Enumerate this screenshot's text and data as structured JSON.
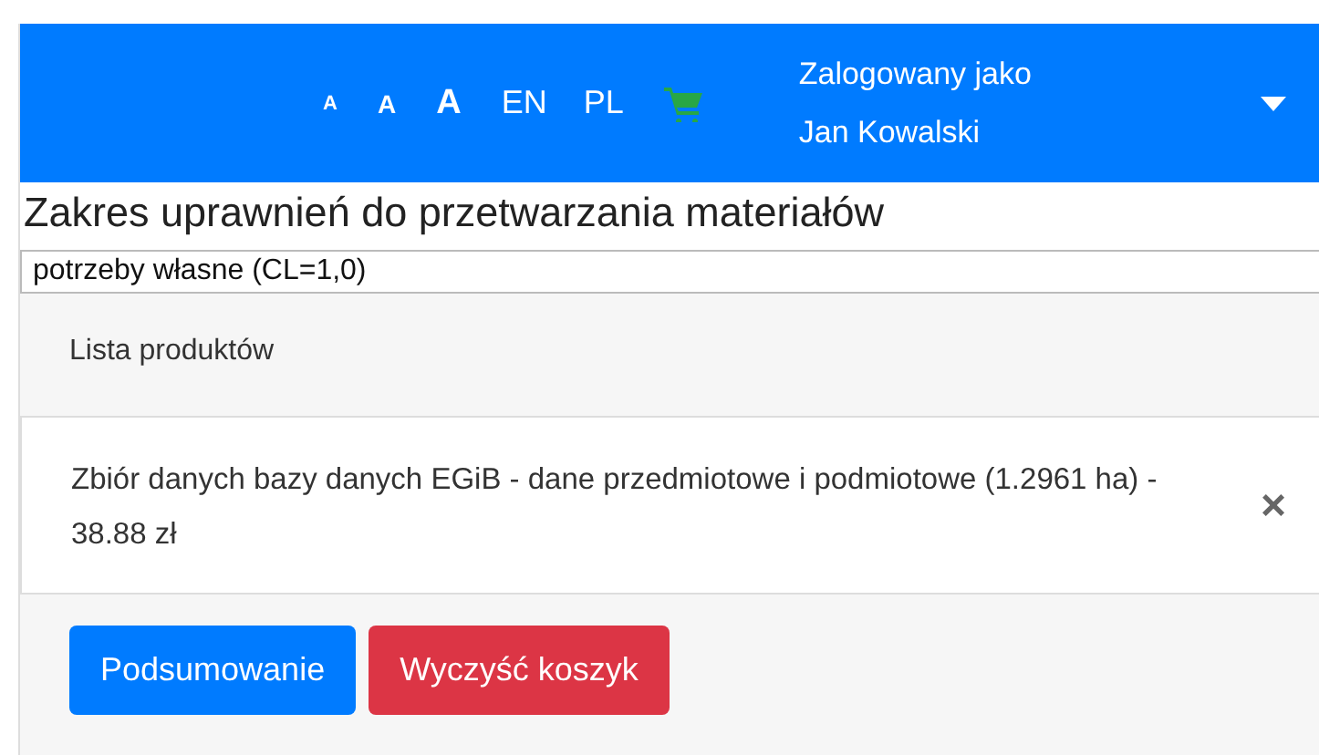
{
  "navbar": {
    "font_sizes": [
      {
        "label": "A",
        "kind": "small"
      },
      {
        "label": "A",
        "kind": "medium"
      },
      {
        "label": "A",
        "kind": "large"
      }
    ],
    "languages": [
      {
        "label": "EN"
      },
      {
        "label": "PL"
      }
    ],
    "user": {
      "line_1": "Zalogowany jako",
      "line_2": "Jan Kowalski"
    }
  },
  "heading": "Zakres uprawnień do przetwarzania materiałów",
  "purpose_field": {
    "value": "potrzeby własne (CL=1,0)"
  },
  "cart": {
    "title": "Lista produktów",
    "items": [
      {
        "text": "Zbiór danych bazy danych EGiB - dane przedmiotowe i podmiotowe (1.2961 ha) - 38.88 zł",
        "remove": "×"
      }
    ],
    "buttons": [
      {
        "label": "Podsumowanie",
        "kind": "primary"
      },
      {
        "label": "Wyczyść koszyk",
        "kind": "danger"
      }
    ]
  }
}
